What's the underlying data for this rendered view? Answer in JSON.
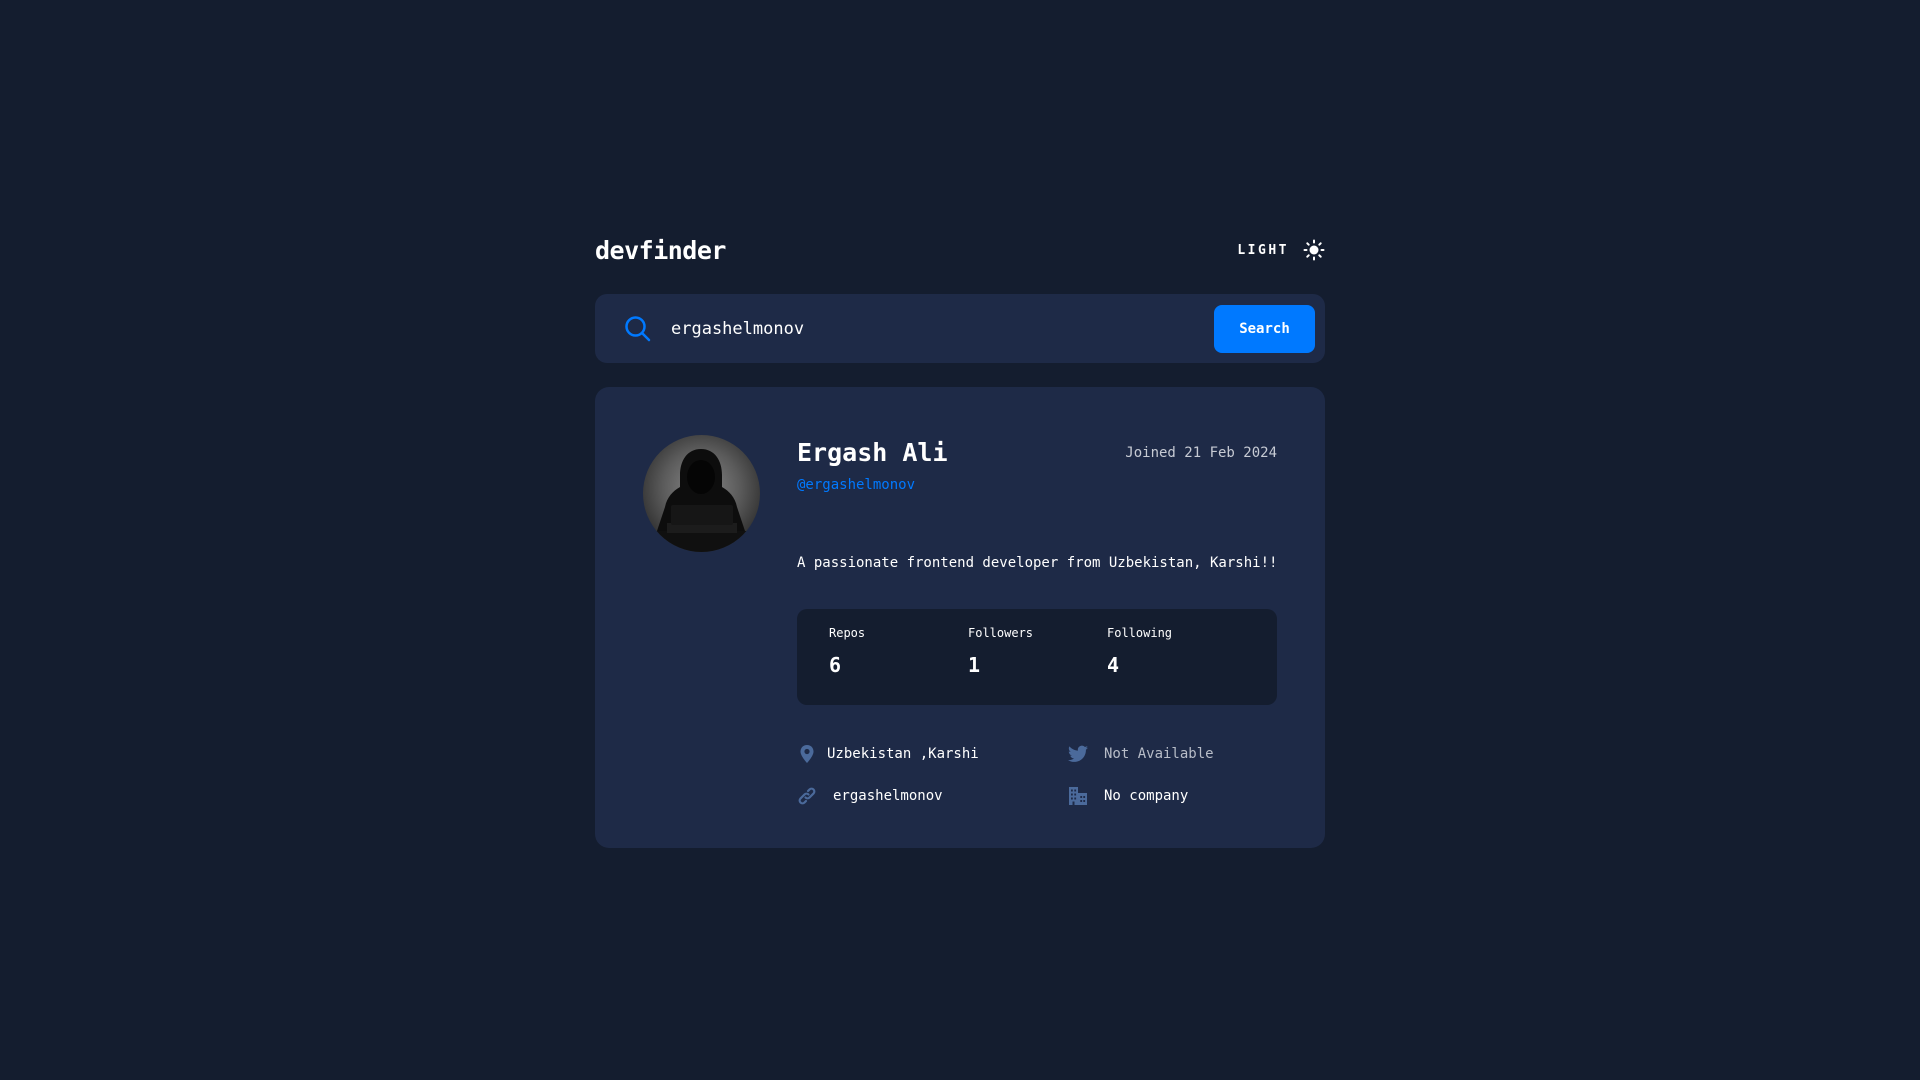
{
  "header": {
    "logo": "devfinder",
    "theme_label": "LIGHT"
  },
  "search": {
    "value": "ergashelmonov",
    "placeholder": "",
    "button_label": "Search"
  },
  "profile": {
    "name": "Ergash Ali",
    "login": "@ergashelmonov",
    "joined": "Joined 21 Feb 2024",
    "bio": "A passionate frontend developer from Uzbekistan, Karshi!!",
    "stats": [
      {
        "label": "Repos",
        "value": "6"
      },
      {
        "label": "Followers",
        "value": "1"
      },
      {
        "label": "Following",
        "value": "4"
      }
    ],
    "links": {
      "location": "Uzbekistan ,Karshi",
      "twitter": "Not Available",
      "website": "ergashelmonov",
      "company": "No company"
    }
  },
  "icons": {
    "theme": "sun-icon",
    "search": "search-icon",
    "location": "location-pin-icon",
    "twitter": "twitter-icon",
    "website": "link-icon",
    "company": "building-icon"
  },
  "colors": {
    "background": "#141d2f",
    "card": "#1e2a47",
    "accent": "#0079ff",
    "muted_icon": "#4b6a9b",
    "text": "#ffffff"
  }
}
